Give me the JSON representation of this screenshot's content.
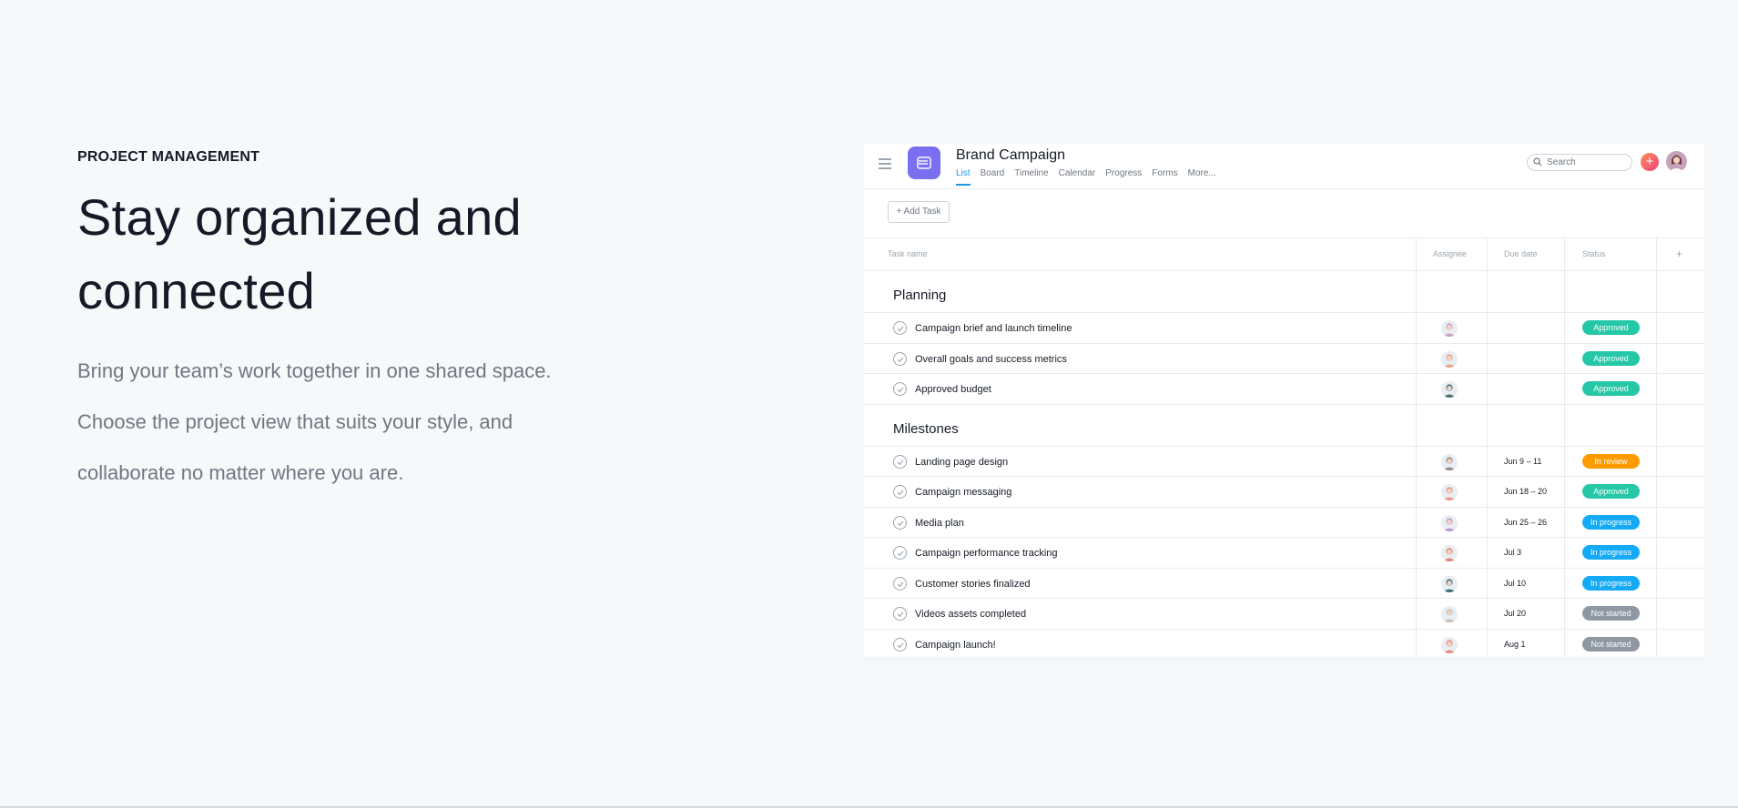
{
  "hero": {
    "eyebrow": "PROJECT MANAGEMENT",
    "headline_line1": "Stay organized and",
    "headline_line2": "connected",
    "body_line1": "Bring your team’s work together in one shared space.",
    "body_line2": "Choose the project view that suits your style, and",
    "body_line3": "collaborate no matter where you are."
  },
  "app": {
    "project_icon": "list-icon",
    "project_title": "Brand Campaign",
    "tabs": [
      {
        "label": "List",
        "active": true
      },
      {
        "label": "Board",
        "active": false
      },
      {
        "label": "Timeline",
        "active": false
      },
      {
        "label": "Calendar",
        "active": false
      },
      {
        "label": "Progress",
        "active": false
      },
      {
        "label": "Forms",
        "active": false
      },
      {
        "label": "More...",
        "active": false
      }
    ],
    "search_placeholder": "Search",
    "add_button": "+",
    "add_task_label": "+ Add Task",
    "columns": {
      "task": "Task name",
      "assignee": "Assignee",
      "due": "Due date",
      "status": "Status",
      "add": "+"
    },
    "status_colors": {
      "Approved": "#25c7a6",
      "In review": "#fd9a00",
      "In progress": "#14aaf5",
      "Not started": "#8d98a3"
    },
    "sections": [
      {
        "title": "Planning",
        "tasks": [
          {
            "name": "Campaign brief and launch timeline",
            "due": "",
            "status": "Approved",
            "avatar_color": "#c9a2c8"
          },
          {
            "name": "Overall goals and success metrics",
            "due": "",
            "status": "Approved",
            "avatar_color": "#e8a48b"
          },
          {
            "name": "Approved budget",
            "due": "",
            "status": "Approved",
            "avatar_color": "#4a6e75"
          }
        ]
      },
      {
        "title": "Milestones",
        "tasks": [
          {
            "name": "Landing page design",
            "due": "Jun 9 – 11",
            "status": "In review",
            "avatar_color": "#8f8a8a"
          },
          {
            "name": "Campaign messaging",
            "due": "Jun 18 – 20",
            "status": "Approved",
            "avatar_color": "#e89b86"
          },
          {
            "name": "Media plan",
            "due": "Jun 25 – 26",
            "status": "In progress",
            "avatar_color": "#b89ac9"
          },
          {
            "name": "Campaign performance tracking",
            "due": "Jul 3",
            "status": "In progress",
            "avatar_color": "#e3827a"
          },
          {
            "name": "Customer stories finalized",
            "due": "Jul 10",
            "status": "In progress",
            "avatar_color": "#3e6f74"
          },
          {
            "name": "Videos assets completed",
            "due": "Jul 20",
            "status": "Not started",
            "avatar_color": "#c4c0bd"
          },
          {
            "name": "Campaign launch!",
            "due": "Aug 1",
            "status": "Not started",
            "avatar_color": "#e28c7b"
          }
        ]
      }
    ]
  }
}
